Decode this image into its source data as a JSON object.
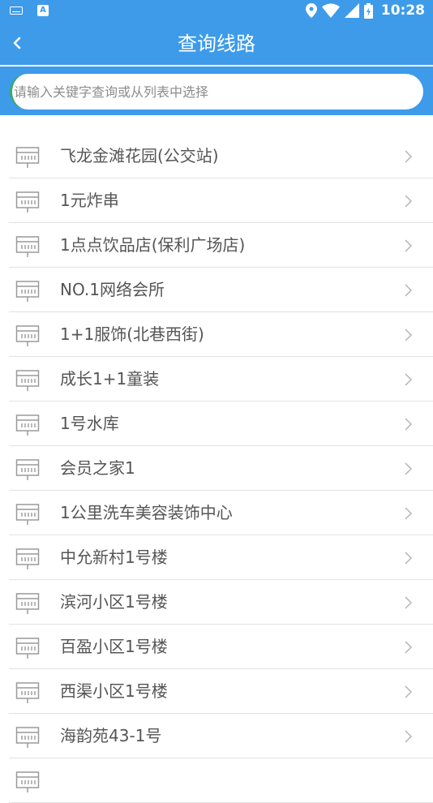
{
  "status_bar": {
    "time": "10:28",
    "icons": [
      "keyboard-icon",
      "a-app-icon",
      "location-icon",
      "wifi-icon",
      "signal-icon",
      "battery-icon"
    ]
  },
  "header": {
    "title": "查询线路",
    "back_icon": "chevron-left-icon"
  },
  "search": {
    "placeholder": "请输入关键字查询或从列表中选择"
  },
  "list": {
    "items": [
      {
        "label": "飞龙金滩花园(公交站)"
      },
      {
        "label": "1元炸串"
      },
      {
        "label": "1点点饮品店(保利广场店)"
      },
      {
        "label": "NO.1网络会所"
      },
      {
        "label": "1+1服饰(北巷西街)"
      },
      {
        "label": "成长1+1童装"
      },
      {
        "label": "1号水库"
      },
      {
        "label": "会员之家1"
      },
      {
        "label": "1公里洗车美容装饰中心"
      },
      {
        "label": "中允新村1号楼"
      },
      {
        "label": "滨河小区1号楼"
      },
      {
        "label": "百盈小区1号楼"
      },
      {
        "label": "西渠小区1号楼"
      },
      {
        "label": "海韵苑43-1号"
      },
      {
        "label": ""
      }
    ]
  },
  "colors": {
    "primary": "#3d9bea",
    "text": "#555555",
    "divider": "#e2e2e2"
  }
}
